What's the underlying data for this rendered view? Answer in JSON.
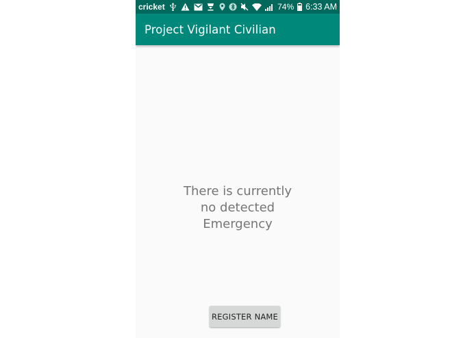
{
  "status_bar": {
    "carrier": "cricket",
    "battery_percent": "74%",
    "time": "6:33 AM",
    "icons": [
      "usb-icon",
      "warning-icon",
      "gmail-icon",
      "download-icon",
      "location-icon",
      "bluetooth-icon",
      "mute-icon",
      "wifi-icon",
      "signal-icon",
      "battery-icon"
    ]
  },
  "app_bar": {
    "title": "Project Vigilant Civilian",
    "color": "#00897b",
    "status_color": "#00695c"
  },
  "main": {
    "message_lines": [
      "There is currently",
      "no detected",
      "Emergency"
    ],
    "register_button_label": "REGISTER NAME"
  }
}
